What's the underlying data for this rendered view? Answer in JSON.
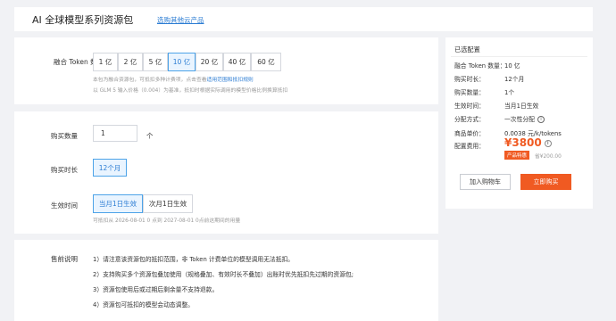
{
  "header": {
    "title": "AI 全球模型系列资源包",
    "other_products_link": "选购其他云产品"
  },
  "token": {
    "label": "融合 Token 数量",
    "options": [
      "1 亿",
      "2 亿",
      "5 亿",
      "10 亿",
      "20 亿",
      "40 亿",
      "60 亿"
    ],
    "selected": "10 亿",
    "desc1_prefix": "本包为融合资源包，可抵扣多种计费项，点击查看",
    "desc1_link": "适用范围和抵扣规则",
    "desc2": "以 GLM 5 输入价格（0.004）为基准，抵扣时根据实际调用的模型价格比例换算抵扣"
  },
  "quantity": {
    "label": "购买数量",
    "value": "1",
    "unit": "个"
  },
  "duration": {
    "label": "购买时长",
    "option": "12个月"
  },
  "effective": {
    "label": "生效时间",
    "options": [
      "当月1日生效",
      "次月1日生效"
    ],
    "selected": "当月1日生效",
    "hint": "可抵扣从 2026-08-01 0 点到 2027-08-01 0点前这期间的用量"
  },
  "notes": {
    "label": "售前说明",
    "items": [
      "1）请注意该资源包的抵扣范围，非 Token 计费单位的模型调用无法抵扣。",
      "2）支持购买多个资源包叠加使用（规格叠加、有效时长不叠加）出账时优先抵扣先过期的资源包;",
      "3）资源包使用后或过期后剩余量不支持退款。",
      "4）资源包可抵扣的模型会动态调整。"
    ]
  },
  "summary": {
    "title": "已选配置",
    "rows": [
      {
        "label": "融合 Token 数量：",
        "value": "10 亿"
      },
      {
        "label": "购买时长：",
        "value": "12个月"
      },
      {
        "label": "购买数量：",
        "value": "1个"
      },
      {
        "label": "生效时间：",
        "value": "当月1日生效"
      },
      {
        "label": "分配方式：",
        "value": "一次性分配"
      },
      {
        "label": "商品单价：",
        "value": "0.0038 元/k/tokens"
      }
    ],
    "cost_label": "配置费用：",
    "price": "¥3800",
    "promo_badge": "产品特惠",
    "original_price": "省¥200.00",
    "add_cart": "加入购物车",
    "buy_now": "立即购买",
    "accent_color": "#f05a22"
  }
}
